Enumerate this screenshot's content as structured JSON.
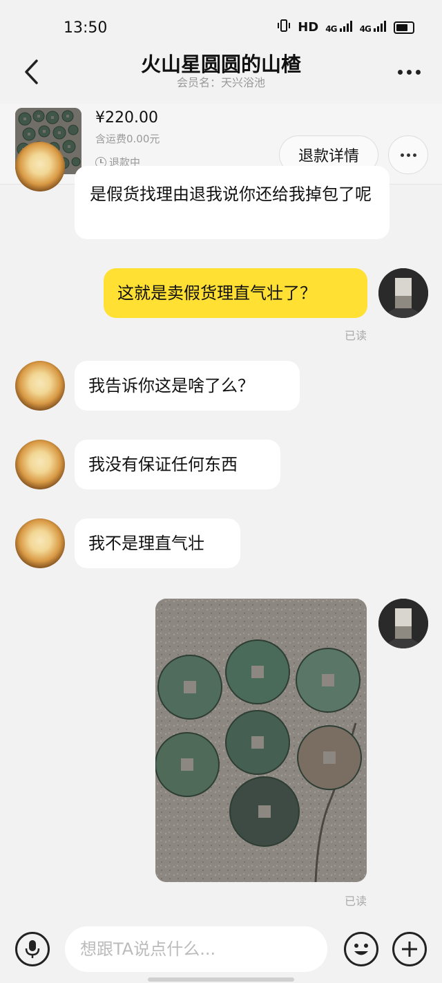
{
  "status_bar": {
    "time": "13:50",
    "network_label": "HD",
    "signal_1": "4G",
    "signal_2": "4G"
  },
  "header": {
    "title": "火山星圆圆的山楂",
    "member_line": "会员名：天兴浴池"
  },
  "product": {
    "price": "¥220.00",
    "shipping": "含运费0.00元",
    "status": "退款中",
    "refund_detail_label": "退款详情"
  },
  "messages": [
    {
      "sender": "other",
      "text": "是假货找理由退我说你还给我掉包了呢"
    },
    {
      "sender": "self",
      "text": "这就是卖假货理直气壮了？",
      "read_label": "已读"
    },
    {
      "sender": "other",
      "text": "我告诉你这是啥了么？"
    },
    {
      "sender": "other",
      "text": "我没有保证任何东西"
    },
    {
      "sender": "other",
      "text": "我不是理直气壮"
    },
    {
      "sender": "self",
      "type": "image",
      "read_label": "已读"
    }
  ],
  "input": {
    "placeholder": "想跟TA说点什么..."
  },
  "colors": {
    "self_bubble": "#ffe033",
    "other_bubble": "#ffffff",
    "background": "#f2f2f2"
  },
  "icons": [
    "back-arrow-icon",
    "more-icon",
    "clock-icon",
    "microphone-icon",
    "emoji-icon",
    "plus-icon"
  ]
}
